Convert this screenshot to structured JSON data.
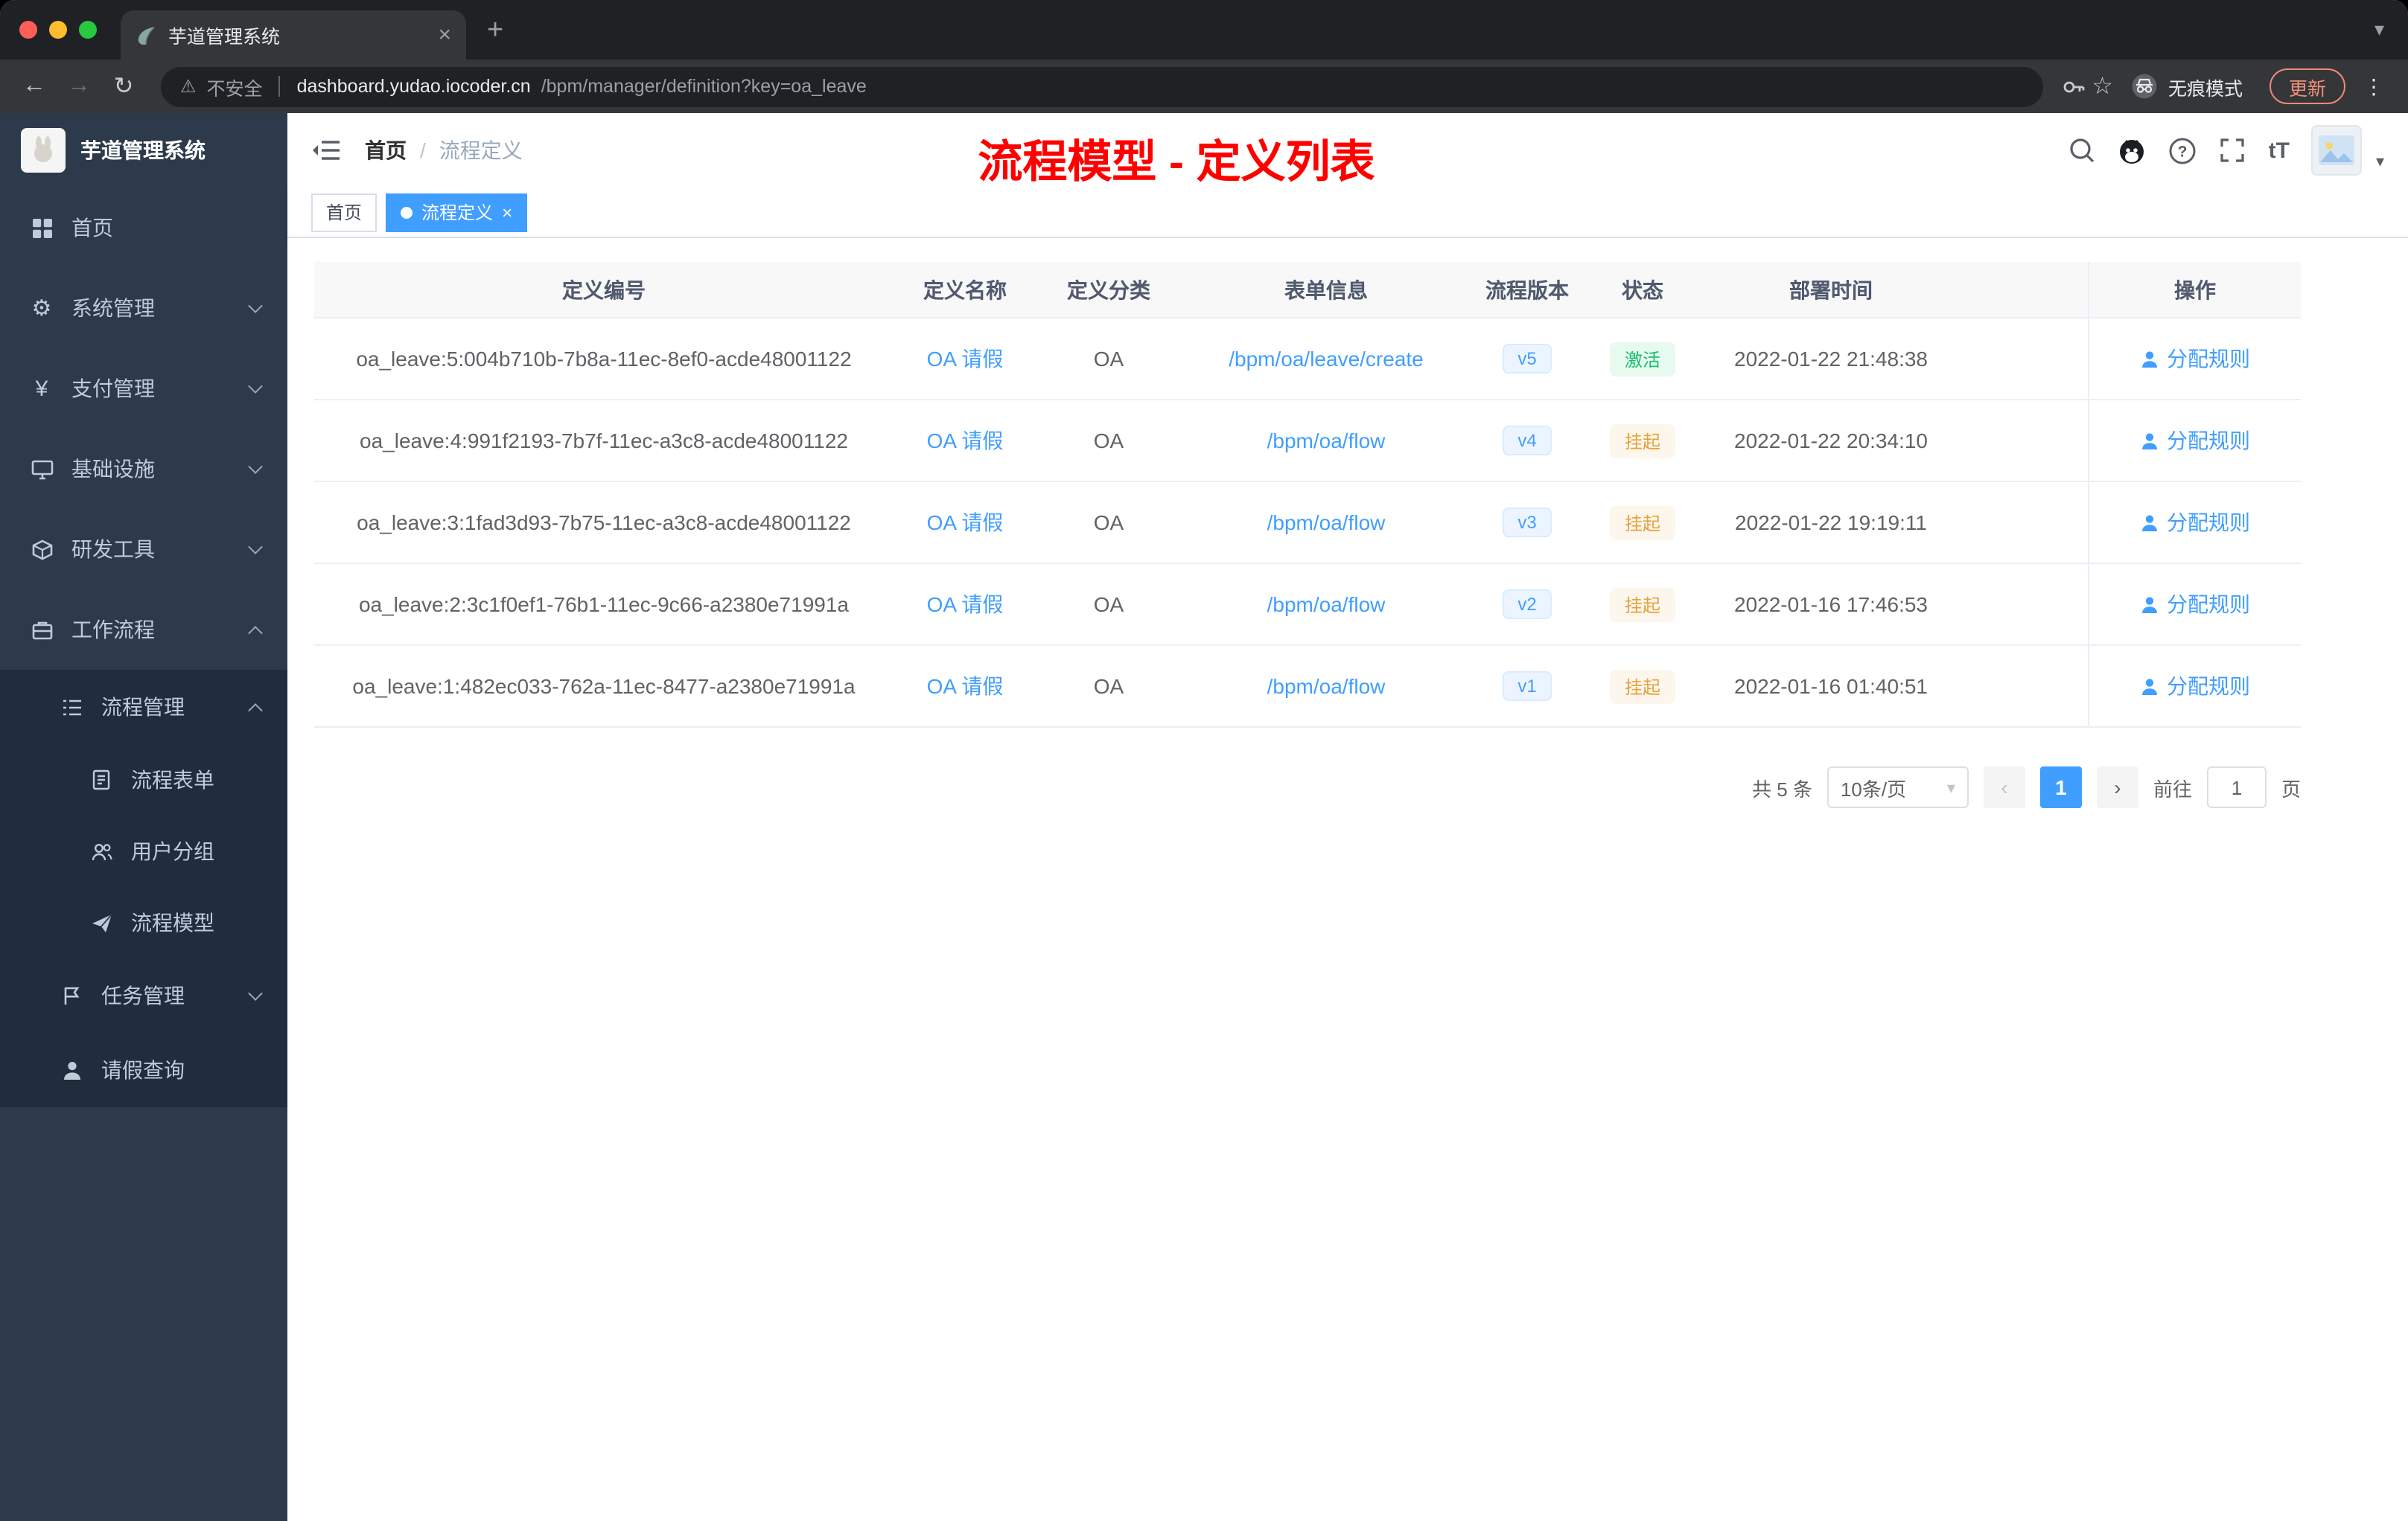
{
  "colors": {
    "accent": "#409eff",
    "success": "#19be6b",
    "warning": "#e6a23c",
    "sidebar_bg": "#2d3a4b",
    "sidebar_sub_bg": "#1f2d3d",
    "annotation_red": "#fe0000",
    "chrome_dark": "#202124",
    "chrome_toolbar": "#35363a"
  },
  "browser": {
    "tab": {
      "title": "芋道管理系统"
    },
    "address": {
      "security": "不安全",
      "host": "dashboard.yudao.iocoder.cn",
      "path": "/bpm/manager/definition?key=oa_leave"
    },
    "incognito_label": "无痕模式",
    "update_label": "更新"
  },
  "icons": {
    "close": "×",
    "plus": "+",
    "more": "⋮",
    "back": "←",
    "forward": "→",
    "refresh": "↻",
    "warning": "⚠",
    "star": "☆",
    "caret_down": "▾",
    "tab_search": "▾",
    "font_size": "tT",
    "gear": "⚙",
    "yen": "¥",
    "prev": "‹",
    "next": "›"
  },
  "sidebar": {
    "logo_title": "芋道管理系统",
    "items": [
      {
        "label": "首页"
      },
      {
        "label": "系统管理"
      },
      {
        "label": "支付管理"
      },
      {
        "label": "基础设施"
      },
      {
        "label": "研发工具"
      },
      {
        "label": "工作流程"
      },
      {
        "label": "流程管理"
      },
      {
        "label": "流程表单"
      },
      {
        "label": "用户分组"
      },
      {
        "label": "流程模型"
      },
      {
        "label": "任务管理"
      },
      {
        "label": "请假查询"
      }
    ]
  },
  "header": {
    "breadcrumb_home": "首页",
    "breadcrumb_sep": "/",
    "breadcrumb_current": "流程定义",
    "annotation": "流程模型 - 定义列表"
  },
  "tags": {
    "home": "首页",
    "active": "流程定义"
  },
  "table": {
    "columns": [
      "定义编号",
      "定义名称",
      "定义分类",
      "表单信息",
      "流程版本",
      "状态",
      "部署时间",
      "操作"
    ],
    "rows": [
      {
        "id": "oa_leave:5:004b710b-7b8a-11ec-8ef0-acde48001122",
        "name": "OA 请假",
        "category": "OA",
        "form": "/bpm/oa/leave/create",
        "version": "v5",
        "status": "激活",
        "time": "2022-01-22 21:48:38",
        "action": "分配规则"
      },
      {
        "id": "oa_leave:4:991f2193-7b7f-11ec-a3c8-acde48001122",
        "name": "OA 请假",
        "category": "OA",
        "form": "/bpm/oa/flow",
        "version": "v4",
        "status": "挂起",
        "time": "2022-01-22 20:34:10",
        "action": "分配规则"
      },
      {
        "id": "oa_leave:3:1fad3d93-7b75-11ec-a3c8-acde48001122",
        "name": "OA 请假",
        "category": "OA",
        "form": "/bpm/oa/flow",
        "version": "v3",
        "status": "挂起",
        "time": "2022-01-22 19:19:11",
        "action": "分配规则"
      },
      {
        "id": "oa_leave:2:3c1f0ef1-76b1-11ec-9c66-a2380e71991a",
        "name": "OA 请假",
        "category": "OA",
        "form": "/bpm/oa/flow",
        "version": "v2",
        "status": "挂起",
        "time": "2022-01-16 17:46:53",
        "action": "分配规则"
      },
      {
        "id": "oa_leave:1:482ec033-762a-11ec-8477-a2380e71991a",
        "name": "OA 请假",
        "category": "OA",
        "form": "/bpm/oa/flow",
        "version": "v1",
        "status": "挂起",
        "time": "2022-01-16 01:40:51",
        "action": "分配规则"
      }
    ]
  },
  "pagination": {
    "total": "共 5 条",
    "page_size": "10条/页",
    "page": "1",
    "goto_label": "前往",
    "goto_value": "1",
    "goto_unit": "页"
  }
}
